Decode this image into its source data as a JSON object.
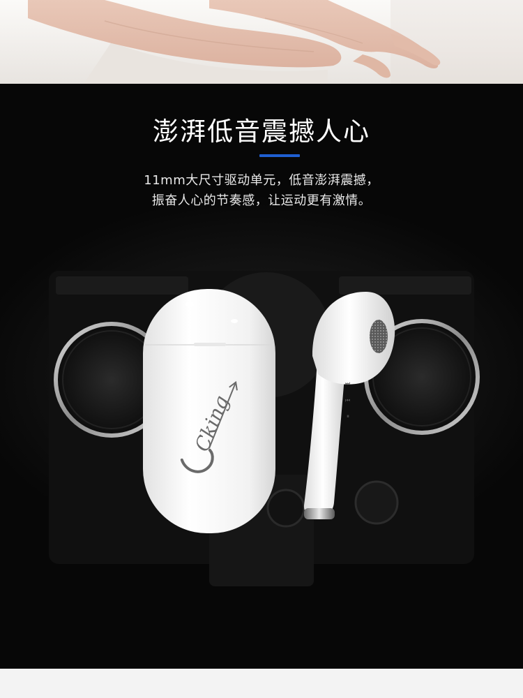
{
  "promo": {
    "headline": "澎湃低音震撼人心",
    "description_lines": [
      "11mm大尺寸驱动单元，低音澎湃震撼，",
      "振奋人心的节奏感，让运动更有激情。"
    ]
  },
  "product": {
    "case_logo_text": "Cking"
  },
  "colors": {
    "panel_background": "#0a0a0a",
    "accent": "#1f5fd1",
    "headline_text": "#ffffff",
    "body_text": "#e9e9e9",
    "product_white": "#f4f4f4"
  }
}
